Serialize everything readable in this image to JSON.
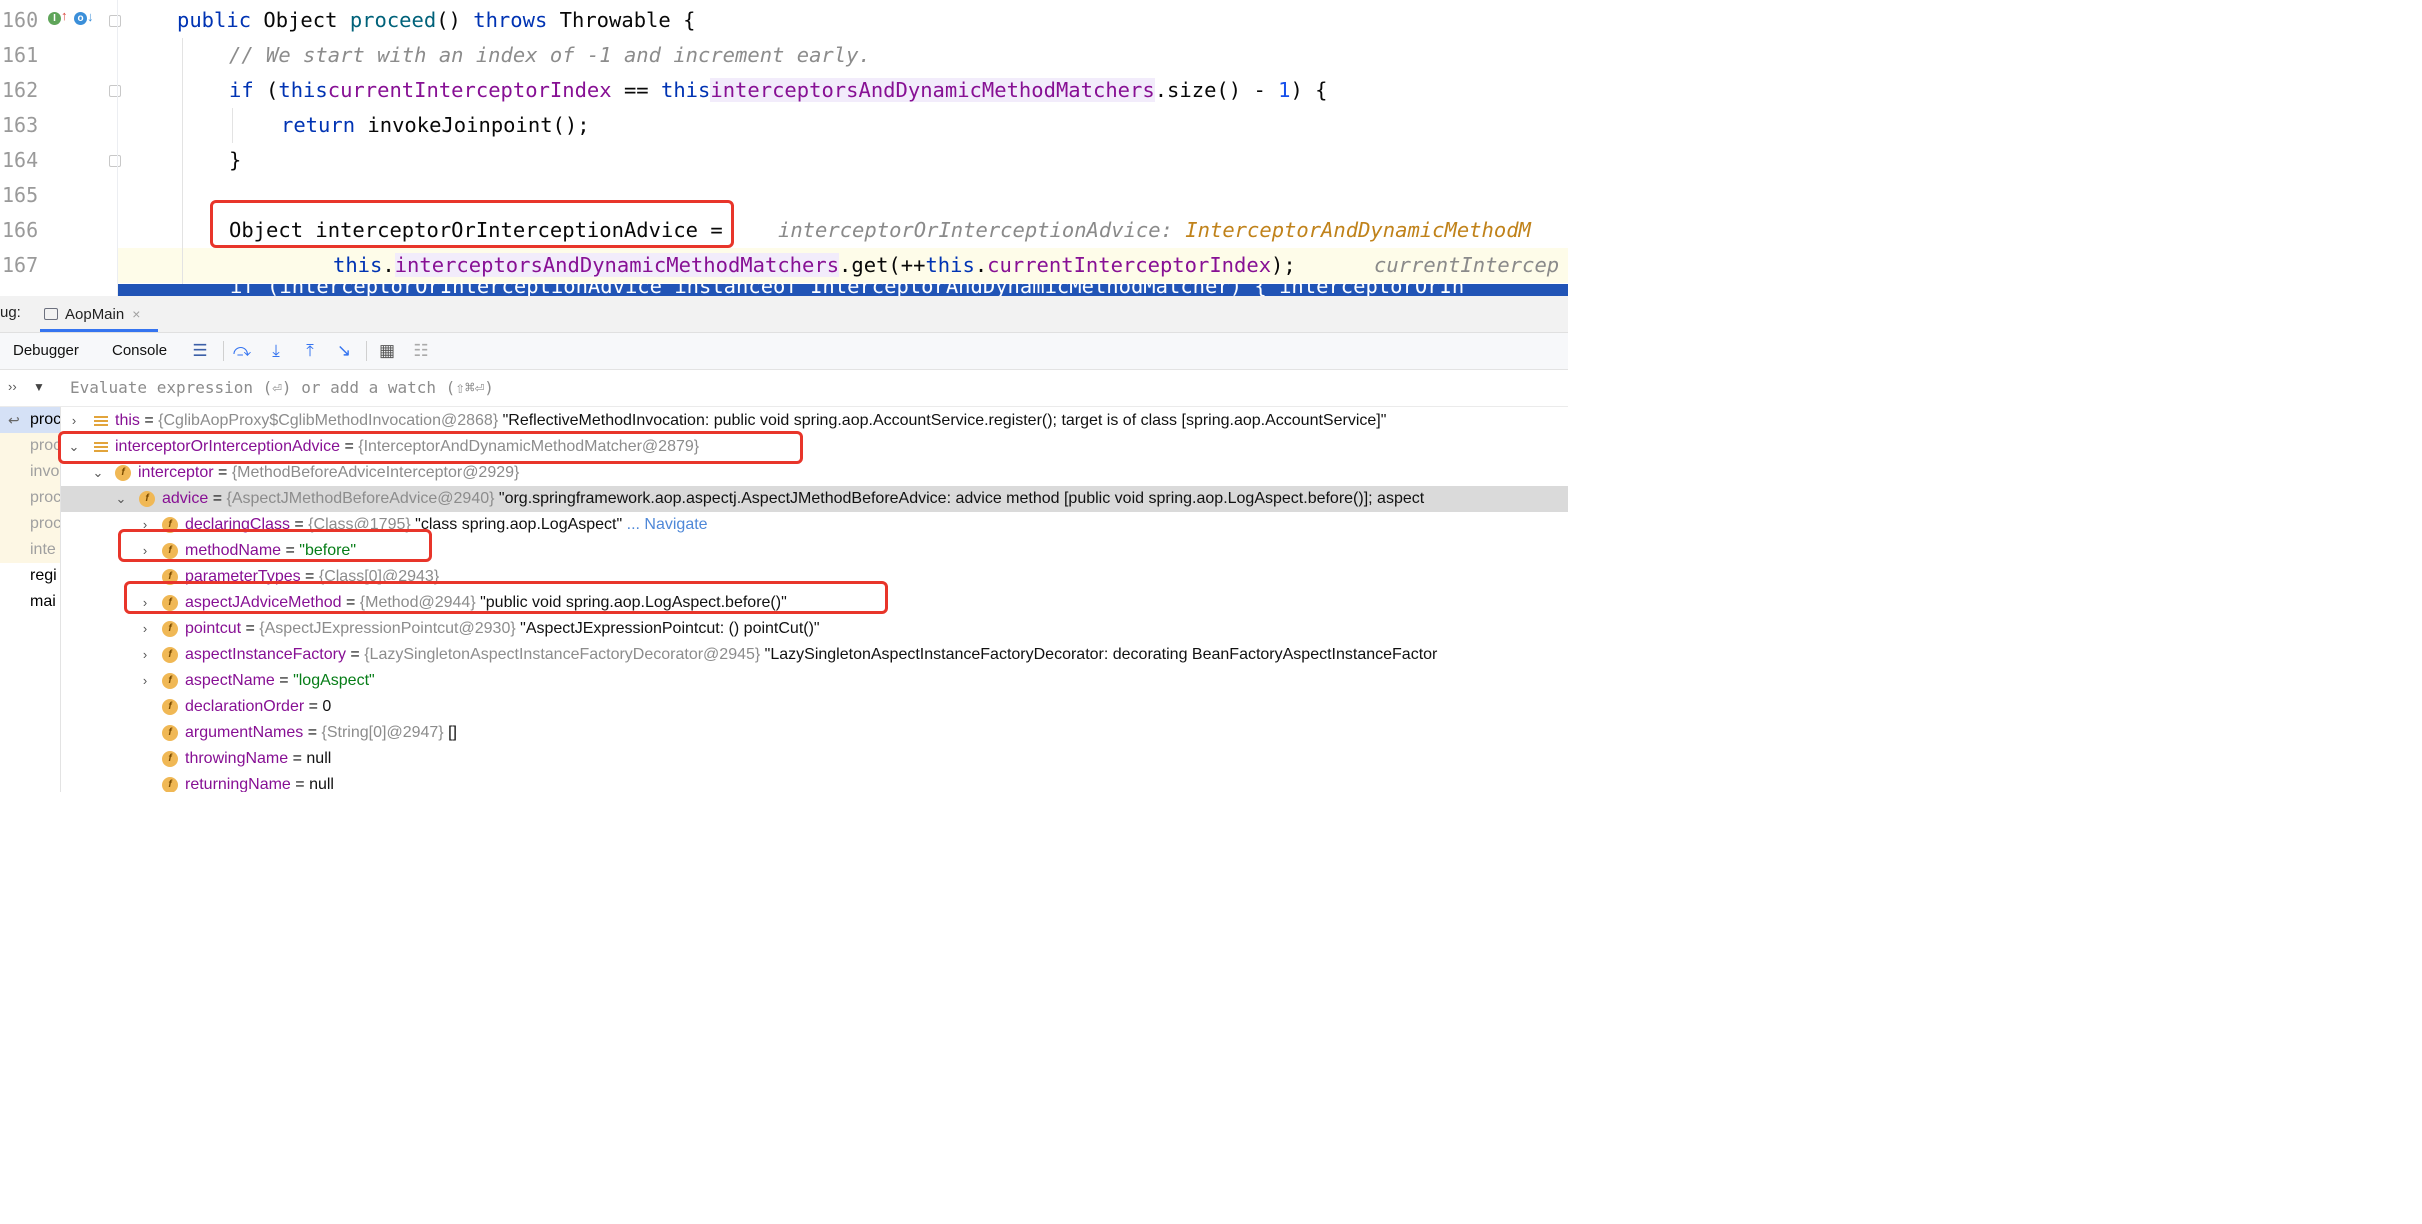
{
  "editor": {
    "line_numbers": [
      "160",
      "161",
      "162",
      "163",
      "164",
      "165",
      "166",
      "167"
    ],
    "lines": {
      "l160": {
        "kw1": "public",
        "type": "Object",
        "method": "proceed",
        "paren": "()",
        "kw2": "throws",
        "rest": "Throwable {"
      },
      "l161": {
        "comment": "// We start with an index of -1 and increment early."
      },
      "l162": {
        "kw_if": "if",
        "p1": "(",
        "this1": "this",
        ".": ".",
        "f1": "currentInterceptorIndex",
        "eq": " == ",
        "this2": "this",
        "f2": "interceptorsAndDynamicMethodMatchers",
        "size": ".size() - ",
        "one": "1",
        "end": ") {"
      },
      "l163": {
        "kw": "return",
        "rest": "invokeJoinpoint();"
      },
      "l164": {
        "brace": "}"
      },
      "l166": {
        "decl": "Object interceptorOrInterceptionAdvice",
        "eq": "=",
        "hint_name": "interceptorOrInterceptionAdvice:",
        "hint_type": "InterceptorAndDynamicMethodM"
      },
      "l167": {
        "this1": "this",
        "f1": "interceptorsAndDynamicMethodMatchers",
        "get": ".get(++",
        "this2": "this",
        "f2": "currentInterceptorIndex",
        "end": ");",
        "hint": "currentIntercep"
      },
      "l168": {
        "text": "if (interceptorOrInterceptionAdvice instanceof InterceptorAndDynamicMethodMatcher) { interceptorOrIn"
      }
    }
  },
  "debug": {
    "label": "ug:",
    "run_tab": "AopMain",
    "run_tab_close": "×",
    "tabs": [
      "Debugger",
      "Console"
    ],
    "toolbar_icons": [
      "threads-icon",
      "step-over-icon",
      "step-into-icon",
      "step-out-icon",
      "run-to-cursor-icon",
      "evaluate-icon",
      "trace-icon"
    ],
    "eval_placeholder": "Evaluate expression (⏎) or add a watch (⇧⌘⏎)",
    "frames": [
      {
        "label": "proc",
        "state": "selected"
      },
      {
        "label": "proc",
        "state": "library"
      },
      {
        "label": "invo",
        "state": "library"
      },
      {
        "label": "proc",
        "state": "library"
      },
      {
        "label": "proc",
        "state": "library"
      },
      {
        "label": "inte",
        "state": "library"
      },
      {
        "label": "regi",
        "state": "normal"
      },
      {
        "label": "mai",
        "state": "normal"
      }
    ],
    "variables": [
      {
        "name": "this",
        "eq": " = ",
        "ref": "{CglibAopProxy$CglibMethodInvocation@2868}",
        "value": " \"ReflectiveMethodInvocation: public void spring.aop.AccountService.register(); target is of class [spring.aop.AccountService]\""
      },
      {
        "name": "interceptorOrInterceptionAdvice",
        "eq": " = ",
        "ref": "{InterceptorAndDynamicMethodMatcher@2879}",
        "value": ""
      },
      {
        "name": "interceptor",
        "eq": " = ",
        "ref": "{MethodBeforeAdviceInterceptor@2929}",
        "value": ""
      },
      {
        "name": "advice",
        "eq": " = ",
        "ref": "{AspectJMethodBeforeAdvice@2940}",
        "value": " \"org.springframework.aop.aspectj.AspectJMethodBeforeAdvice: advice method [public void spring.aop.LogAspect.before()]; aspect"
      },
      {
        "name": "declaringClass",
        "eq": " = ",
        "ref": "{Class@1795}",
        "value": " \"class spring.aop.LogAspect\"",
        "nav": " ... Navigate"
      },
      {
        "name": "methodName",
        "eq": " = ",
        "str": "\"before\""
      },
      {
        "name": "parameterTypes",
        "eq": " = ",
        "ref": "{Class[0]@2943}"
      },
      {
        "name": "aspectJAdviceMethod",
        "eq": " = ",
        "ref": "{Method@2944}",
        "value": " \"public void spring.aop.LogAspect.before()\""
      },
      {
        "name": "pointcut",
        "eq": " = ",
        "ref": "{AspectJExpressionPointcut@2930}",
        "value": " \"AspectJExpressionPointcut: () pointCut()\""
      },
      {
        "name": "aspectInstanceFactory",
        "eq": " = ",
        "ref": "{LazySingletonAspectInstanceFactoryDecorator@2945}",
        "value": " \"LazySingletonAspectInstanceFactoryDecorator: decorating BeanFactoryAspectInstanceFactor"
      },
      {
        "name": "aspectName",
        "eq": " = ",
        "str": "\"logAspect\""
      },
      {
        "name": "declarationOrder",
        "eq": " = ",
        "value": "0"
      },
      {
        "name": "argumentNames",
        "eq": " = ",
        "ref": "{String[0]@2947}",
        "value": " []"
      },
      {
        "name": "throwingName",
        "eq": " = ",
        "value": "null"
      },
      {
        "name": "returningName",
        "eq": " = ",
        "value": "null"
      }
    ]
  },
  "colors": {
    "highlight_box": "#e8352a",
    "exec_line": "#2154b6",
    "selected_row": "#dadada"
  }
}
